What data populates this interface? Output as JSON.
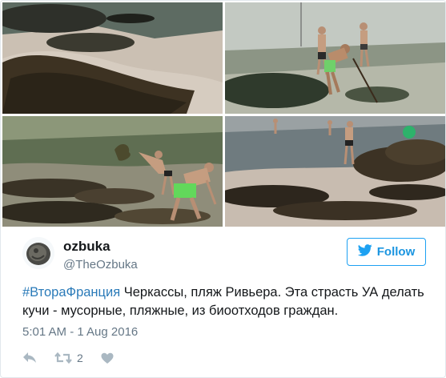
{
  "user": {
    "display_name": "ozbuka",
    "screen_name": "@TheOzbuka"
  },
  "follow": {
    "label": "Follow",
    "icon": "twitter-bird-icon"
  },
  "tweet": {
    "hashtag": "#ВтораФранция",
    "text": " Черкассы, пляж Ривьера. Эта страсть УА делать кучи - мусорные, пляжные, из биоотходов граждан.",
    "timestamp": "5:01 AM - 1 Aug 2016"
  },
  "actions": {
    "reply_icon": "reply-icon",
    "retweet_icon": "retweet-icon",
    "retweet_count": "2",
    "like_icon": "heart-icon"
  },
  "colors": {
    "accent": "#1da1f2",
    "link": "#2b7bb9",
    "muted": "#657786",
    "icon": "#aab8c2"
  },
  "photos": [
    {
      "subject": "seaweed-pile-on-beach"
    },
    {
      "subject": "men-raking-seaweed-in-water"
    },
    {
      "subject": "men-piling-seaweed"
    },
    {
      "subject": "seaweed-heaps-on-shore"
    }
  ]
}
